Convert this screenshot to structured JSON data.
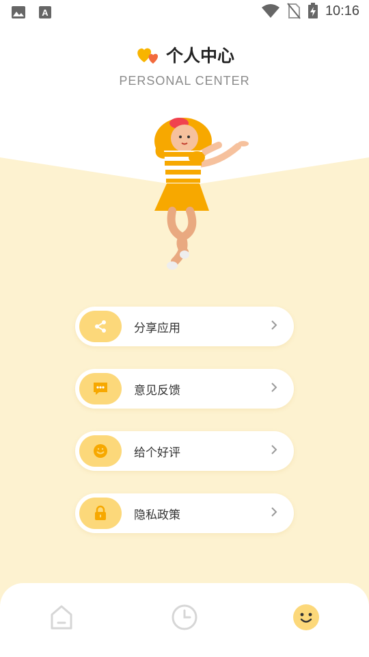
{
  "status_bar": {
    "time": "10:16",
    "icons": [
      "gallery-icon",
      "text-icon",
      "wifi-icon",
      "no-sim-icon",
      "battery-charging-icon"
    ]
  },
  "header": {
    "title": "个人中心",
    "subtitle": "PERSONAL CENTER",
    "logo_icon": "hearts-icon"
  },
  "menu": [
    {
      "label": "分享应用",
      "icon": "share-icon"
    },
    {
      "label": "意见反馈",
      "icon": "chat-bubble-icon"
    },
    {
      "label": "给个好评",
      "icon": "smile-icon"
    },
    {
      "label": "隐私政策",
      "icon": "lock-icon"
    }
  ],
  "tabs": [
    {
      "name": "home",
      "icon": "home-icon"
    },
    {
      "name": "history",
      "icon": "clock-icon"
    },
    {
      "name": "profile",
      "icon": "smiley-face-icon",
      "active": true
    }
  ],
  "colors": {
    "accent": "#fcd87a",
    "background_band": "#fdf2d0",
    "icon_inactive": "#d6d6d6",
    "active_tab": "#fcd87a"
  }
}
